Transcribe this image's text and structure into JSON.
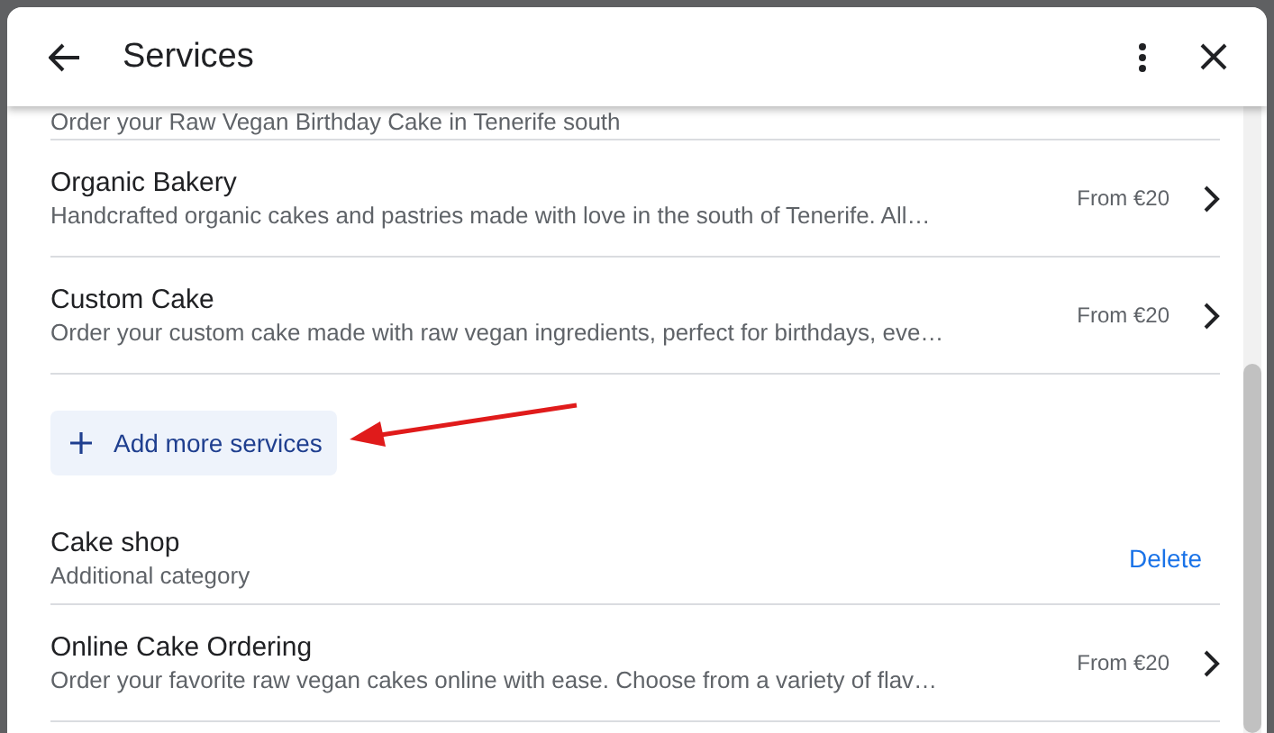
{
  "dialog": {
    "title": "Services"
  },
  "items": [
    {
      "kind": "snippet",
      "description": "Order your Raw Vegan Birthday Cake in Tenerife south"
    },
    {
      "kind": "service",
      "title": "Organic Bakery",
      "description": "Handcrafted organic cakes and pastries made with love in the south of Tenerife. All…",
      "price": "From €20"
    },
    {
      "kind": "service",
      "title": "Custom Cake",
      "description": "Order your custom cake made with raw vegan ingredients, perfect for birthdays, eve…",
      "price": "From €20"
    },
    {
      "kind": "add",
      "label": "Add more services"
    },
    {
      "kind": "category",
      "title": "Cake shop",
      "subtitle": "Additional category",
      "action": "Delete"
    },
    {
      "kind": "service",
      "title": "Online Cake Ordering",
      "description": "Order your favorite raw vegan cakes online with ease. Choose from a variety of flav…",
      "price": "From €20"
    }
  ]
}
